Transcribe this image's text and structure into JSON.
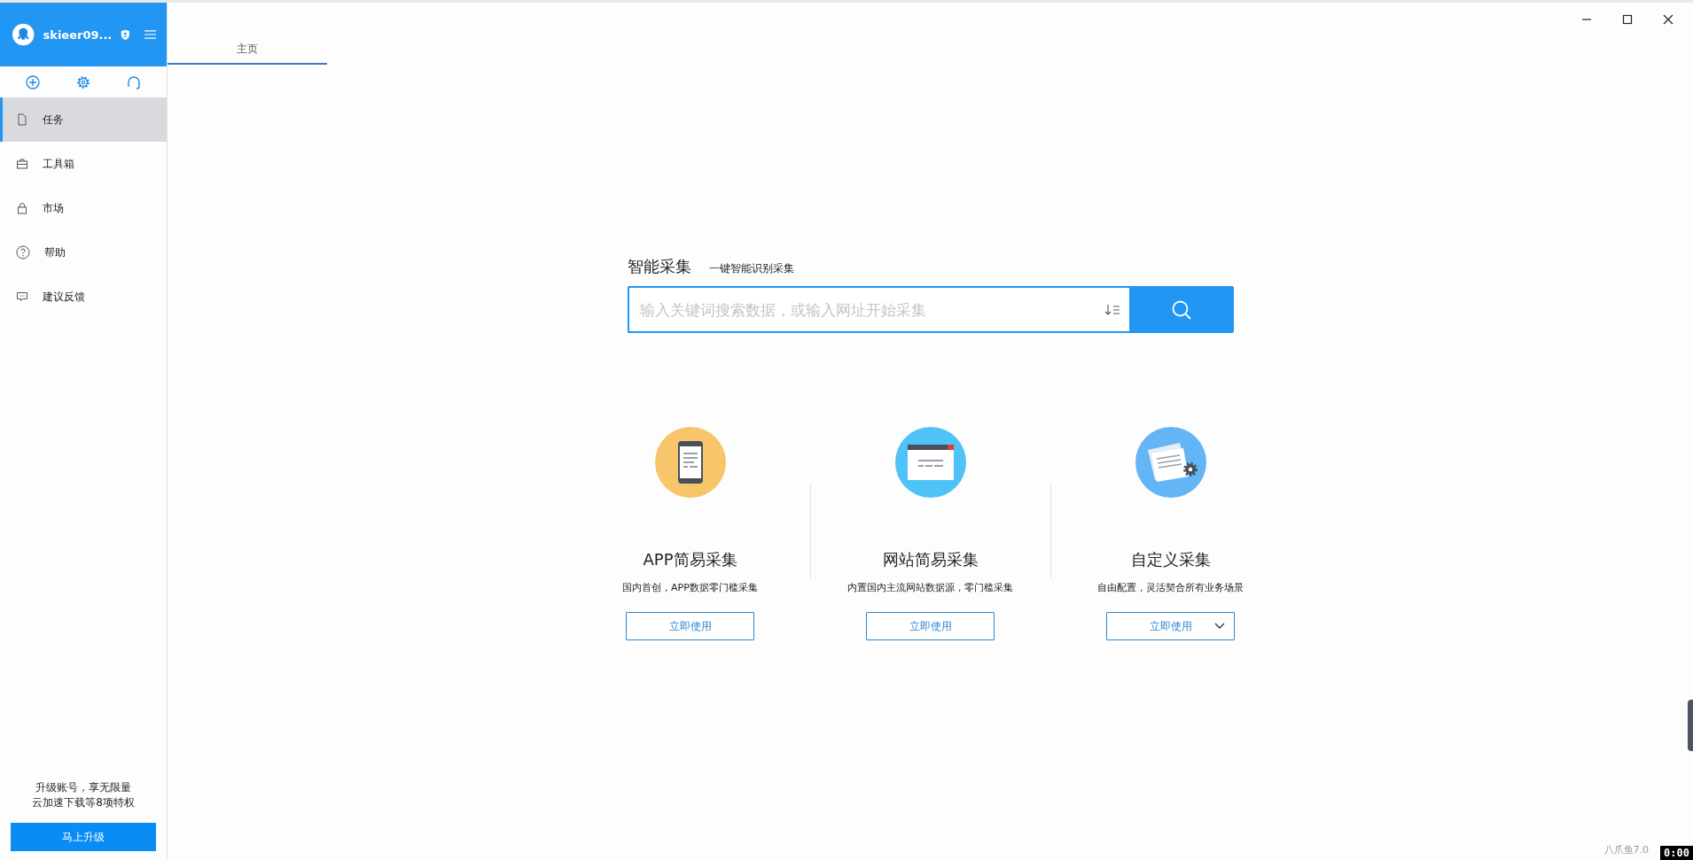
{
  "user": {
    "name": "skieer09..."
  },
  "sidebar": {
    "items": [
      {
        "label": "任务",
        "kind": "file",
        "selected": true
      },
      {
        "label": "工具箱",
        "kind": "toolbox",
        "selected": false
      },
      {
        "label": "市场",
        "kind": "bag",
        "selected": false
      },
      {
        "label": "帮助",
        "kind": "help",
        "selected": false
      },
      {
        "label": "建议反馈",
        "kind": "feedback",
        "selected": false
      }
    ],
    "promo": [
      "升级账号，享无限量",
      "云加速下载等8项特权"
    ],
    "upgrade_button": "马上升级"
  },
  "tabs": [
    {
      "label": "主页",
      "selected": true
    }
  ],
  "smart": {
    "title": "智能采集",
    "subtitle": "一键智能识别采集",
    "placeholder": "输入关键词搜索数据，或输入网址开始采集"
  },
  "cards": [
    {
      "kind": "app",
      "title": "APP简易采集",
      "description": "国内首创，APP数据零门槛采集",
      "button": "立即使用",
      "dropdown": false
    },
    {
      "kind": "web",
      "title": "网站简易采集",
      "description": "内置国内主流网站数据源，零门槛采集",
      "button": "立即使用",
      "dropdown": false
    },
    {
      "kind": "custom",
      "title": "自定义采集",
      "description": "自由配置，灵活契合所有业务场景",
      "button": "立即使用",
      "dropdown": true
    }
  ],
  "version": "八爪鱼7.0",
  "timer": "0:00"
}
